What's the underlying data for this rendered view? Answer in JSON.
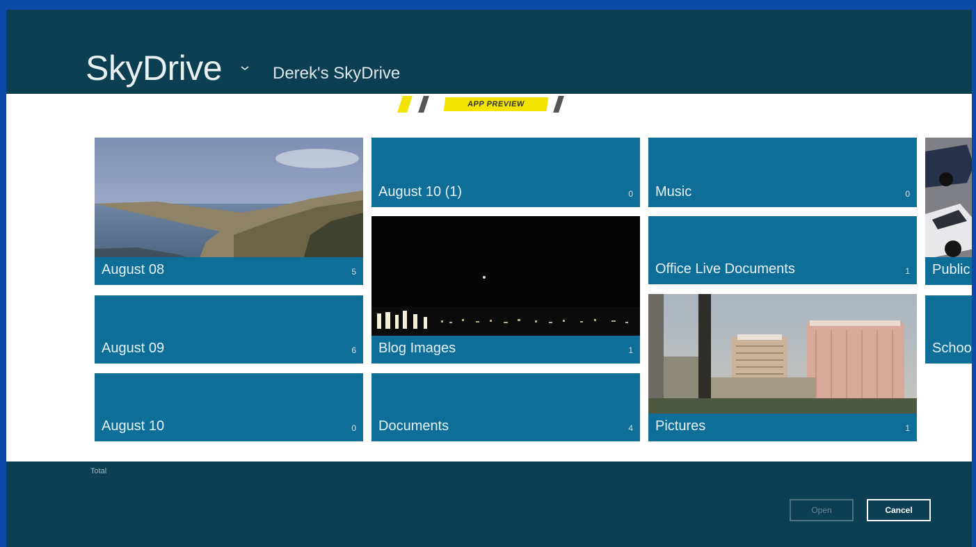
{
  "header": {
    "app_title": "SkyDrive",
    "location": "Derek's SkyDrive"
  },
  "banner": {
    "label": "APP PREVIEW"
  },
  "tiles": [
    {
      "label": "August 08",
      "count": "5"
    },
    {
      "label": "August 09",
      "count": "6"
    },
    {
      "label": "August 10",
      "count": "0"
    },
    {
      "label": "August 10 (1)",
      "count": "0"
    },
    {
      "label": "Blog Images",
      "count": "1"
    },
    {
      "label": "Documents",
      "count": "4"
    },
    {
      "label": "Music",
      "count": "0"
    },
    {
      "label": "Office Live Documents",
      "count": "1"
    },
    {
      "label": "Pictures",
      "count": "1"
    },
    {
      "label": "Public",
      "count": ""
    },
    {
      "label": "School",
      "count": ""
    }
  ],
  "appbar": {
    "selected_label": "Total",
    "open_label": "Open",
    "cancel_label": "Cancel"
  },
  "colors": {
    "header_bg": "#0d3f52",
    "tile_bg": "#0f6e98",
    "banner_yellow": "#f2e400",
    "frame_border": "#0b4aa8"
  }
}
